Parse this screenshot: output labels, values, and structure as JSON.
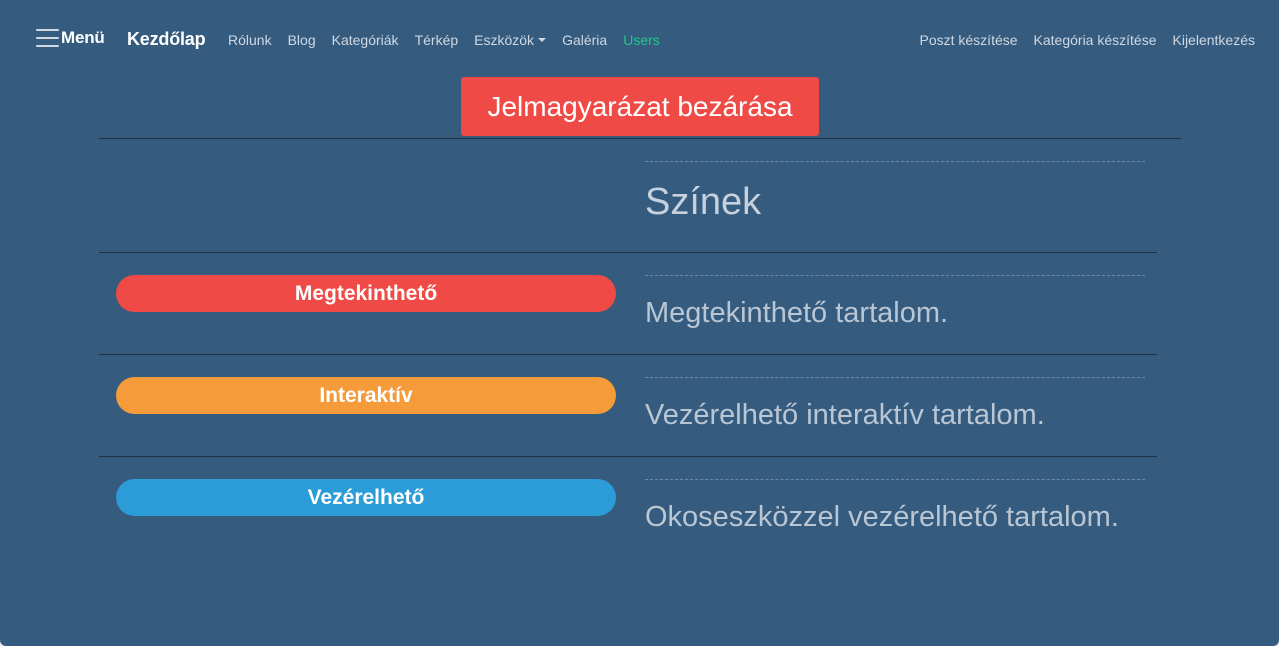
{
  "nav": {
    "menu_label": "Menü",
    "brand": "Kezdőlap",
    "links": [
      {
        "label": "Rólunk"
      },
      {
        "label": "Blog"
      },
      {
        "label": "Kategóriák"
      },
      {
        "label": "Térkép"
      },
      {
        "label": "Eszközök"
      },
      {
        "label": "Galéria"
      },
      {
        "label": "Users"
      }
    ],
    "right_links": [
      {
        "label": "Poszt készítése"
      },
      {
        "label": "Kategória készítése"
      },
      {
        "label": "Kijelentkezés"
      }
    ],
    "active_color": "#1fc98b"
  },
  "legend": {
    "close_label": "Jelmagyarázat bezárása",
    "heading": "Színek",
    "rows": [
      {
        "label": "Megtekinthető",
        "description": "Megtekinthető tartalom.",
        "color": "#ef4a46"
      },
      {
        "label": "Interaktív",
        "description": "Vezérelhető interaktív tartalom.",
        "color": "#f59b3a"
      },
      {
        "label": "Vezérelhető",
        "description": "Okoseszközzel vezérelhető tartalom.",
        "color": "#2b9cd8"
      }
    ]
  },
  "colors": {
    "background": "#355b7e",
    "close_button": "#ef4a46"
  }
}
